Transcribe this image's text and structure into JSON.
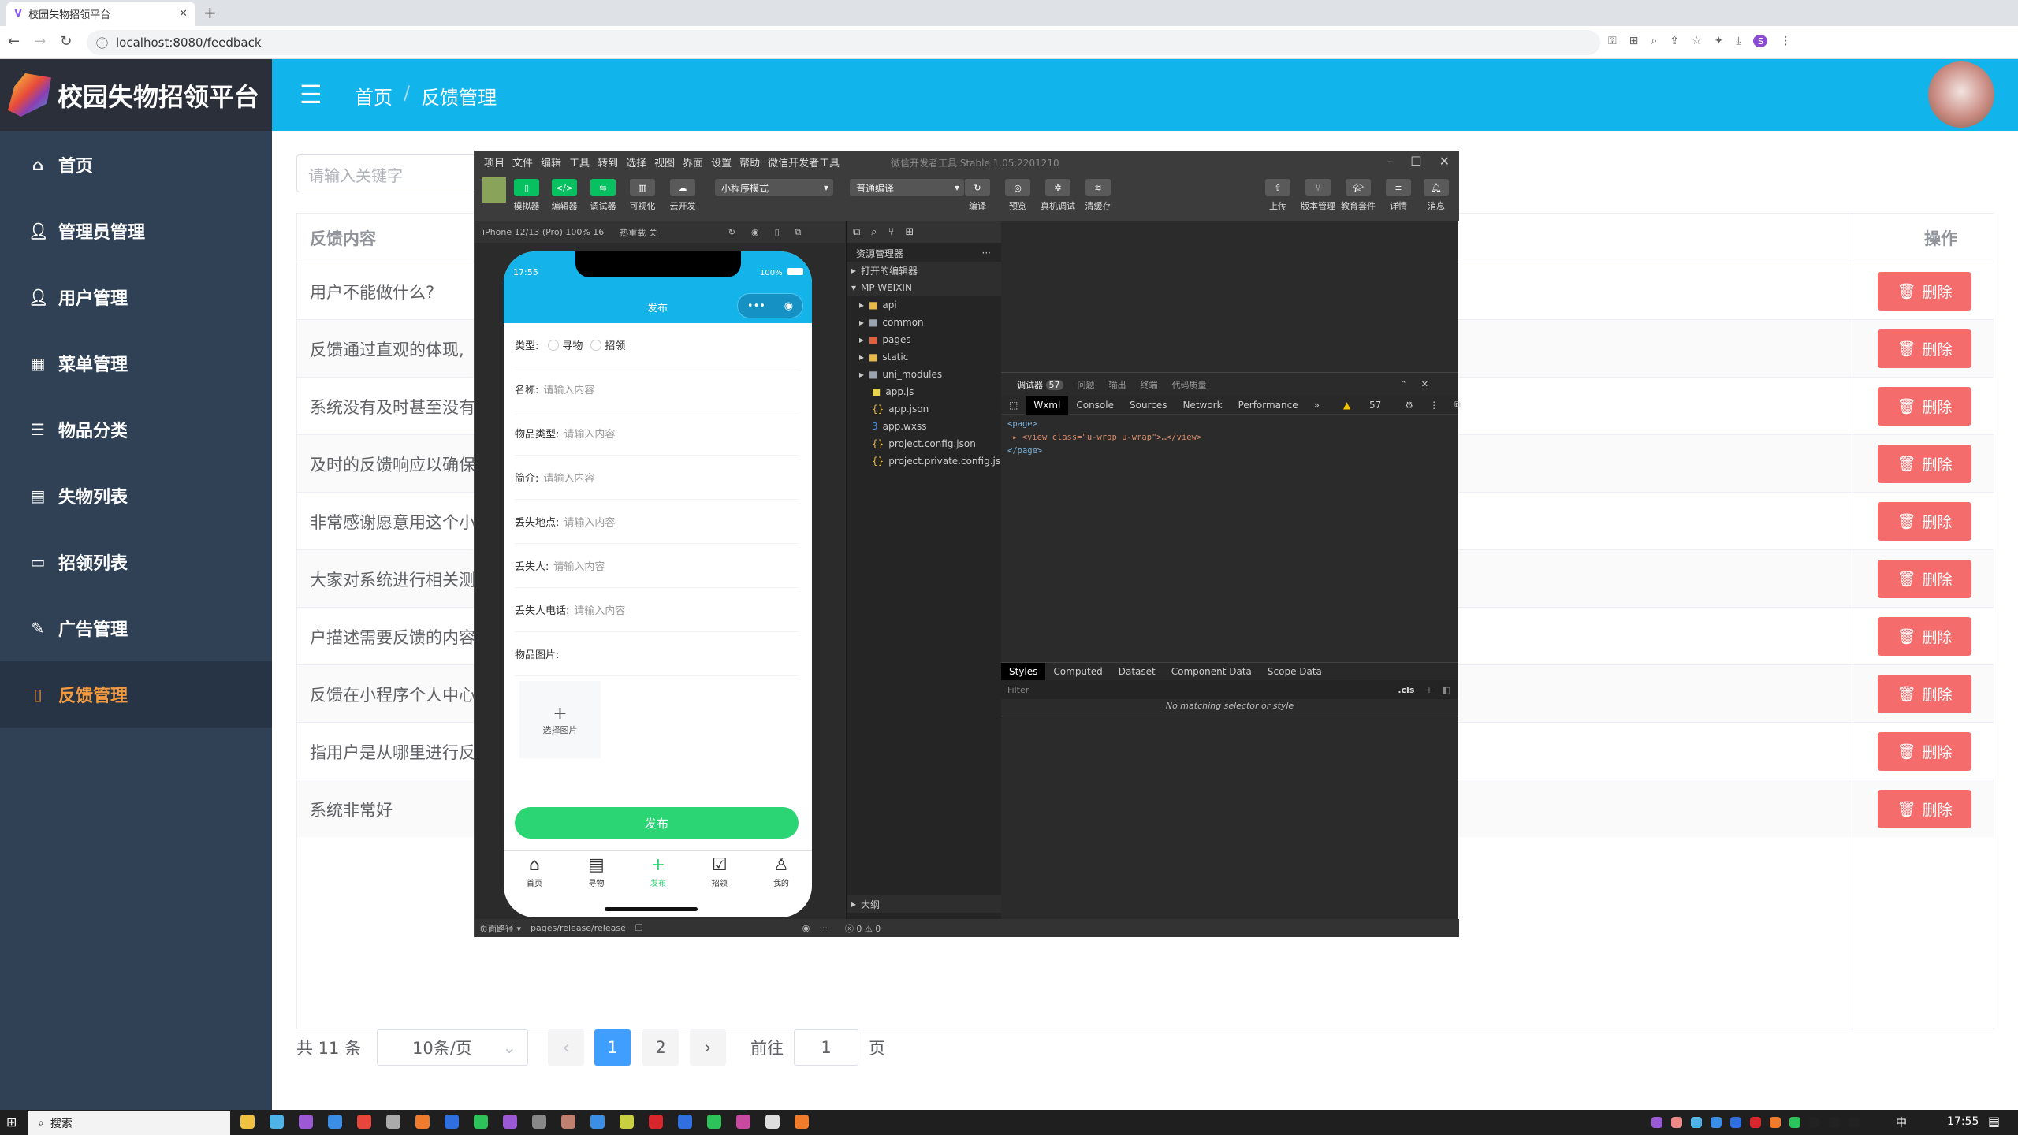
{
  "browser": {
    "tab_title": "校园失物招领平台",
    "url": "localhost:8080/feedback"
  },
  "app": {
    "title": "校园失物招领平台",
    "breadcrumb": [
      "首页",
      "反馈管理"
    ],
    "search_placeholder": "请输入关键字",
    "sidebar": [
      {
        "label": "首页",
        "icon": "home-icon"
      },
      {
        "label": "管理员管理",
        "icon": "user-icon"
      },
      {
        "label": "用户管理",
        "icon": "user-icon"
      },
      {
        "label": "菜单管理",
        "icon": "grid-icon"
      },
      {
        "label": "物品分类",
        "icon": "sliders-icon"
      },
      {
        "label": "失物列表",
        "icon": "document-icon"
      },
      {
        "label": "招领列表",
        "icon": "monitor-icon"
      },
      {
        "label": "广告管理",
        "icon": "edit-icon"
      },
      {
        "label": "反馈管理",
        "icon": "file-icon",
        "active": true
      }
    ],
    "table": {
      "headers": [
        "反馈内容",
        "操作"
      ],
      "delete_label": "删除",
      "rows": [
        "用户不能做什么?",
        "反馈通过直观的体现,",
        "系统没有及时甚至没有",
        "及时的反馈响应以确保",
        "非常感谢愿意用这个小",
        "大家对系统进行相关测",
        "户描述需要反馈的内容",
        "反馈在小程序个人中心",
        "指用户是从哪里进行反",
        "系统非常好"
      ]
    },
    "pagination": {
      "total": "共 11 条",
      "page_size": "10条/页",
      "pages": [
        "1",
        "2"
      ],
      "current": 1,
      "goto_label": "前往",
      "goto_value": "1",
      "page_suffix": "页"
    },
    "colors": {
      "header": "#11b5ec",
      "sidebar": "#304156",
      "active": "#f39a3f",
      "danger": "#f56c6c",
      "primary": "#409eff"
    }
  },
  "devtools": {
    "menu": [
      "项目",
      "文件",
      "编辑",
      "工具",
      "转到",
      "选择",
      "视图",
      "界面",
      "设置",
      "帮助",
      "微信开发者工具"
    ],
    "title": "微信开发者工具 Stable 1.05.2201210",
    "toolbar_left": [
      "模拟器",
      "编辑器",
      "调试器",
      "可视化",
      "云开发"
    ],
    "mode": "小程序模式",
    "compile": "普通编译",
    "toolbar_mid": [
      "编译",
      "预览",
      "真机调试",
      "清缓存"
    ],
    "toolbar_right": [
      "上传",
      "版本管理",
      "教育套件",
      "详情",
      "消息"
    ],
    "device": "iPhone 12/13 (Pro) 100% 16",
    "hot_reload": "热重载 关",
    "phone": {
      "time": "17:55",
      "battery": "100%",
      "nav_title": "发布",
      "type_label": "类型:",
      "type_options": [
        "寻物",
        "招领"
      ],
      "fields": [
        {
          "label": "名称:",
          "placeholder": "请输入内容"
        },
        {
          "label": "物品类型:",
          "placeholder": "请输入内容"
        },
        {
          "label": "简介:",
          "placeholder": "请输入内容"
        },
        {
          "label": "丢失地点:",
          "placeholder": "请输入内容"
        },
        {
          "label": "丢失人:",
          "placeholder": "请输入内容"
        },
        {
          "label": "丢失人电话:",
          "placeholder": "请输入内容"
        }
      ],
      "image_label": "物品图片:",
      "choose_image": "选择图片",
      "submit": "发布",
      "tabs": [
        "首页",
        "寻物",
        "发布",
        "招领",
        "我的"
      ]
    },
    "explorer": {
      "title": "资源管理器",
      "open_editors": "打开的编辑器",
      "project": "MP-WEIXIN",
      "items": [
        "api",
        "common",
        "pages",
        "static",
        "uni_modules",
        "app.js",
        "app.json",
        "app.wxss",
        "project.config.json",
        "project.private.config.js..."
      ],
      "outline": "大纲"
    },
    "debug_tabs": [
      "调试器",
      "问题",
      "输出",
      "终端",
      "代码质量"
    ],
    "debug_count": "57",
    "panel_tabs": [
      "Wxml",
      "Console",
      "Sources",
      "Network",
      "Performance"
    ],
    "warnings": "57",
    "code": [
      "<page>",
      "<view class=\"u-wrap u-wrap\">…</view>",
      "</page>"
    ],
    "style_tabs": [
      "Styles",
      "Computed",
      "Dataset",
      "Component Data",
      "Scope Data"
    ],
    "filter_placeholder": "Filter",
    "cls": ".cls",
    "no_match": "No matching selector or style",
    "status_path_label": "页面路径",
    "status_path": "pages/release/release",
    "status_errors": "0",
    "status_warnings": "0"
  },
  "taskbar": {
    "search": "搜索",
    "ime": "中",
    "time": "17:55"
  }
}
